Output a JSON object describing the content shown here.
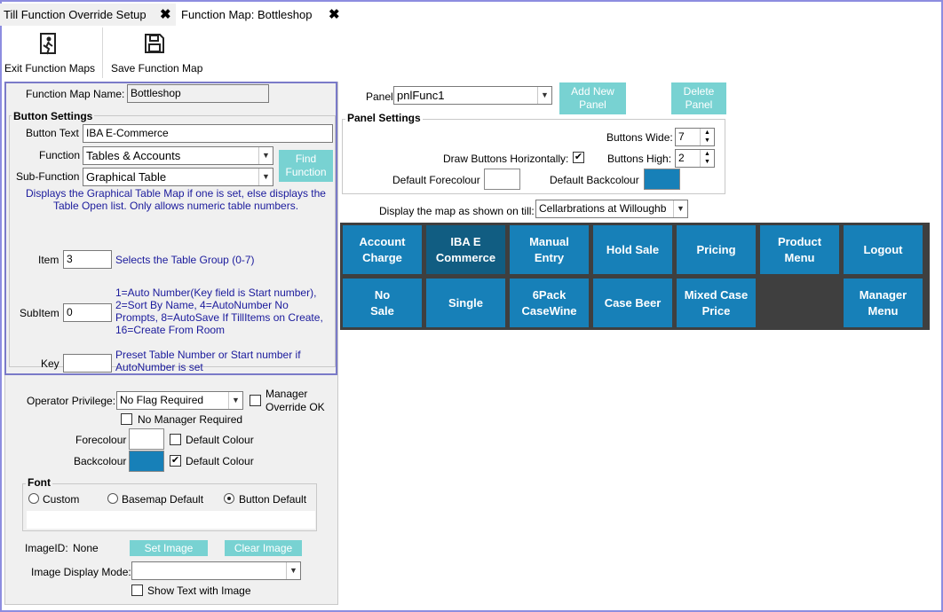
{
  "tabs": [
    {
      "label": "Till Function Override Setup",
      "close": "✖"
    },
    {
      "label": "Function Map: Bottleshop",
      "close": "✖"
    }
  ],
  "toolbar": {
    "exit_label": "Exit Function Maps",
    "save_label": "Save Function Map"
  },
  "map": {
    "name_label": "Function Map Name:",
    "name_value": "Bottleshop"
  },
  "button_settings": {
    "title": "Button Settings",
    "text_label": "Button Text",
    "text_value": "IBA E-Commerce",
    "function_label": "Function",
    "function_value": "Tables & Accounts",
    "subfunction_label": "Sub-Function",
    "subfunction_value": "Graphical Table",
    "find_label": "Find Function",
    "description": "Displays the Graphical Table Map if one is set, else displays the Table Open list. Only allows numeric table numbers.",
    "item_label": "Item",
    "item_value": "3",
    "item_help": "Selects the Table Group (0-7)",
    "subitem_label": "SubItem",
    "subitem_value": "0",
    "subitem_help": "1=Auto Number(Key field is Start number), 2=Sort By Name, 4=AutoNumber No Prompts, 8=AutoSave If TillItems on Create, 16=Create From Room",
    "key_label": "Key",
    "key_value": "",
    "key_help": "Preset Table Number or Start number if AutoNumber is set"
  },
  "privilege": {
    "label": "Operator Privilege:",
    "value": "No Flag Required",
    "manager_override": "Manager Override OK",
    "no_manager": "No Manager Required"
  },
  "colours": {
    "fore_label": "Forecolour",
    "back_label": "Backcolour",
    "default_label": "Default Colour",
    "fore_hex": "#ffffff",
    "back_hex": "#1780b8"
  },
  "font": {
    "title": "Font",
    "custom": "Custom",
    "basemap": "Basemap Default",
    "button_default": "Button Default"
  },
  "image": {
    "id_label": "ImageID:",
    "id_value": "None",
    "set_label": "Set Image",
    "clear_label": "Clear Image",
    "mode_label": "Image Display Mode:",
    "mode_value": "",
    "show_text_label": "Show Text with Image"
  },
  "panel": {
    "label": "Panel",
    "value": "pnlFunc1",
    "add_label": "Add New Panel",
    "delete_label": "Delete Panel",
    "settings_title": "Panel Settings",
    "wide_label": "Buttons Wide:",
    "wide_value": "7",
    "draw_horizontal_label": "Draw Buttons Horizontally:",
    "high_label": "Buttons High:",
    "high_value": "2",
    "default_fore_label": "Default Forecolour",
    "default_back_label": "Default Backcolour",
    "default_fore_hex": "#ffffff",
    "default_back_hex": "#1780b8"
  },
  "display_till": {
    "label": "Display the map as shown on till:",
    "value": "Cellarbrations at Willoughb"
  },
  "function_buttons": [
    [
      "Account\nCharge",
      "IBA E\nCommerce",
      "Manual\nEntry",
      "Hold Sale",
      "Pricing",
      "Product\nMenu",
      "Logout"
    ],
    [
      "No\nSale",
      "Single",
      "6Pack\nCaseWine",
      "Case Beer",
      "Mixed Case\nPrice",
      "",
      "Manager\nMenu"
    ]
  ],
  "accent": "#78d2d2",
  "button_color": "#1780b8"
}
